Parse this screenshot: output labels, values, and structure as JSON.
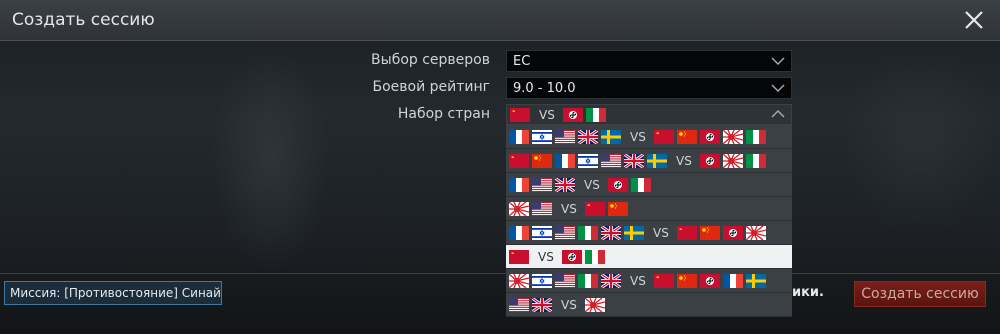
{
  "window": {
    "title": "Создать сессию"
  },
  "form": {
    "server": {
      "label": "Выбор серверов",
      "value": "ЕС"
    },
    "rating": {
      "label": "Боевой рейтинг",
      "value": "9.0 - 10.0"
    },
    "nations": {
      "label": "Набор стран",
      "vs": "VS",
      "selected": {
        "left": [
          "ussr"
        ],
        "right": [
          "germany",
          "italy"
        ]
      },
      "options": [
        {
          "left": [
            "france",
            "israel",
            "usa",
            "uk",
            "sweden"
          ],
          "right": [
            "ussr",
            "china",
            "germany",
            "japan",
            "italy"
          ]
        },
        {
          "left": [
            "ussr",
            "china",
            "france",
            "israel",
            "usa",
            "uk",
            "sweden"
          ],
          "right": [
            "germany",
            "japan",
            "italy"
          ]
        },
        {
          "left": [
            "france",
            "usa",
            "uk"
          ],
          "right": [
            "germany",
            "italy"
          ]
        },
        {
          "left": [
            "japan",
            "usa"
          ],
          "right": [
            "ussr",
            "china"
          ]
        },
        {
          "left": [
            "france",
            "israel",
            "usa",
            "italy",
            "uk",
            "sweden"
          ],
          "right": [
            "ussr",
            "china",
            "germany",
            "japan"
          ]
        },
        {
          "left": [
            "ussr"
          ],
          "right": [
            "germany",
            "italy"
          ],
          "selected": true
        },
        {
          "left": [
            "japan",
            "israel",
            "usa",
            "italy",
            "uk"
          ],
          "right": [
            "ussr",
            "china",
            "germany",
            "france",
            "sweden"
          ]
        },
        {
          "left": [
            "usa",
            "uk"
          ],
          "right": [
            "japan"
          ]
        }
      ]
    }
  },
  "footer": {
    "mission": "Миссия: [Противостояние] Синай",
    "truncated_text": "ики.",
    "create_button": "Создать сессию"
  },
  "colors": {
    "accent": "#7a1f18",
    "mission_border": "#3e78a6"
  }
}
